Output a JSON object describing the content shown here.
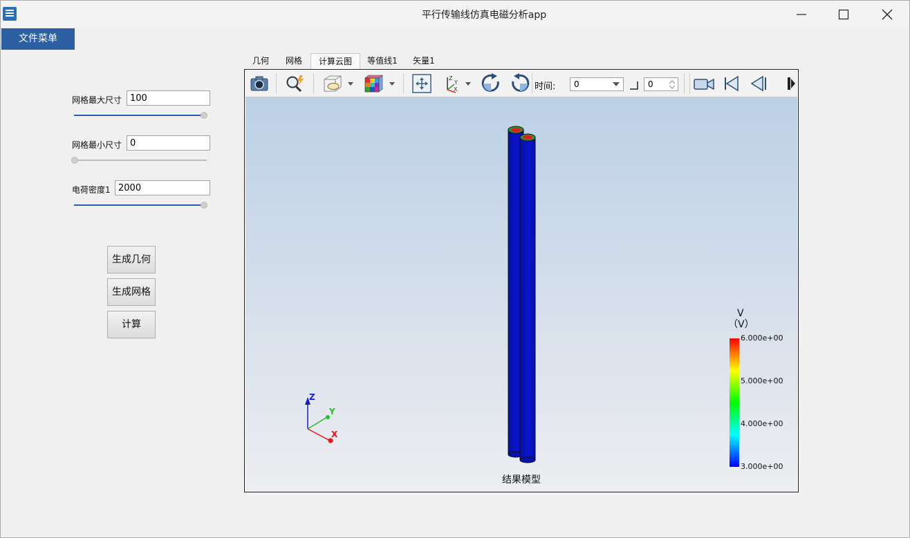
{
  "window": {
    "title": "平行传输线仿真电磁分析app",
    "controls": [
      "minimize",
      "maximize",
      "close"
    ]
  },
  "menu": {
    "file_menu": "文件菜单"
  },
  "left_panel": {
    "max_mesh_label": "网格最大尺寸",
    "max_mesh_value": "100",
    "max_mesh_slider": 1.0,
    "min_mesh_label": "网格最小尺寸",
    "min_mesh_value": "0",
    "min_mesh_slider": 0.0,
    "charge_density_label": "电荷密度1",
    "charge_density_value": "2000",
    "charge_density_slider": 1.0,
    "buttons": {
      "build_geometry": "生成几何",
      "build_mesh": "生成网格",
      "compute": "计算"
    }
  },
  "tabs": [
    {
      "label": "几何",
      "active": false
    },
    {
      "label": "网格",
      "active": false
    },
    {
      "label": "计算云图",
      "active": true
    },
    {
      "label": "等值线1",
      "active": false
    },
    {
      "label": "矢量1",
      "active": false
    }
  ],
  "toolbar": {
    "icons": [
      "camera-icon",
      "zoom-icon",
      "visibility-icon",
      "colormap-icon",
      "fit-view-icon",
      "axes-orientation-icon",
      "rotate-cw-icon",
      "rotate-ccw-icon",
      "video-icon",
      "first-frame-icon",
      "prev-frame-icon",
      "next-frame-icon"
    ],
    "time_label": "时间:",
    "time_value": "0",
    "frame_value": "0"
  },
  "viewport": {
    "caption": "结果模型",
    "axes": {
      "x": "X",
      "y": "Y",
      "z": "Z"
    },
    "axis_colors": {
      "x": "#e8141a",
      "y": "#22c22a",
      "z": "#1a1acc"
    },
    "model_color": "#0a14c8",
    "colorbar": {
      "quantity": "V",
      "unit": "（V）",
      "ticks": [
        "6.000e+00",
        "5.000e+00",
        "4.000e+00",
        "3.000e+00"
      ],
      "colors": [
        "#ff0000",
        "#ffff00",
        "#00ff00",
        "#00ffff",
        "#0000ff"
      ]
    }
  }
}
